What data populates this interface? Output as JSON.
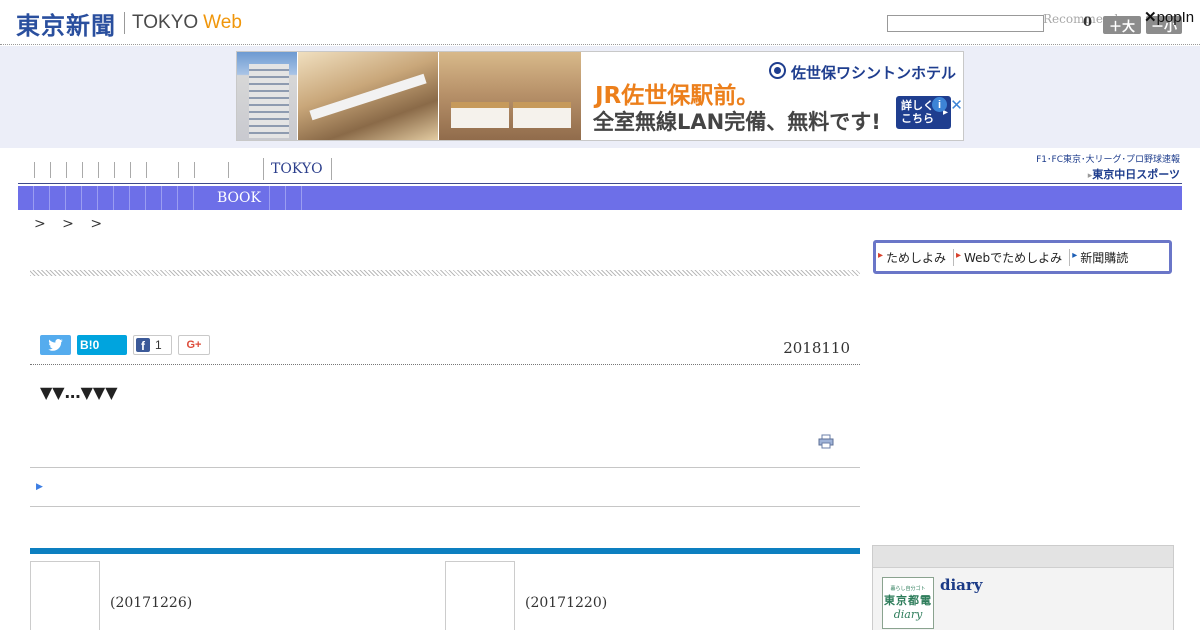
{
  "header": {
    "logo_jp": "東京新聞",
    "logo_tokyo": "TOKYO",
    "logo_web": "Web",
    "search_placeholder": "",
    "recommend": "Recommend",
    "fontsize_count": "0",
    "btn_large": "＋大",
    "btn_small": "－小",
    "popin_x": "✕",
    "popin": "popIn"
  },
  "ad": {
    "hotel_name": "佐世保ワシントンホテル",
    "headline": "JR佐世保駅前。",
    "subline": "全室無線LAN完備、無料です!",
    "more_line1": "詳しくは",
    "more_line2": "こちら",
    "info": "i",
    "close": "✕"
  },
  "nav": {
    "tokyo": "TOKYO",
    "book": "BOOK",
    "chunichi_line1": "F1･FC東京･大リーグ･プロ野球速報",
    "chunichi_line2": "東京中日スポーツ"
  },
  "breadcrumb": "> > >",
  "subscribe": {
    "trial": "ためしよみ",
    "web_trial": "Webでためしよみ",
    "subscribe": "新聞購読"
  },
  "share": {
    "hatena": "B!0",
    "facebook_count": "1",
    "gplus": "G+"
  },
  "article": {
    "date": "2018110",
    "title": "▼▼…▼▼▼"
  },
  "related": [
    {
      "date": "(20171226)"
    },
    {
      "date": "(20171220)"
    }
  ],
  "sidebar": {
    "diary_title": "diary",
    "diary_thumb_line1": "暮らし自分ゴト",
    "diary_thumb_line2": "東京都電",
    "diary_thumb_line3": "diary"
  },
  "colors": {
    "nav_bar": "#6d6fe8",
    "logo_blue": "#2a4f9e",
    "logo_orange": "#f0960a",
    "related_rule": "#0d7fc0"
  }
}
